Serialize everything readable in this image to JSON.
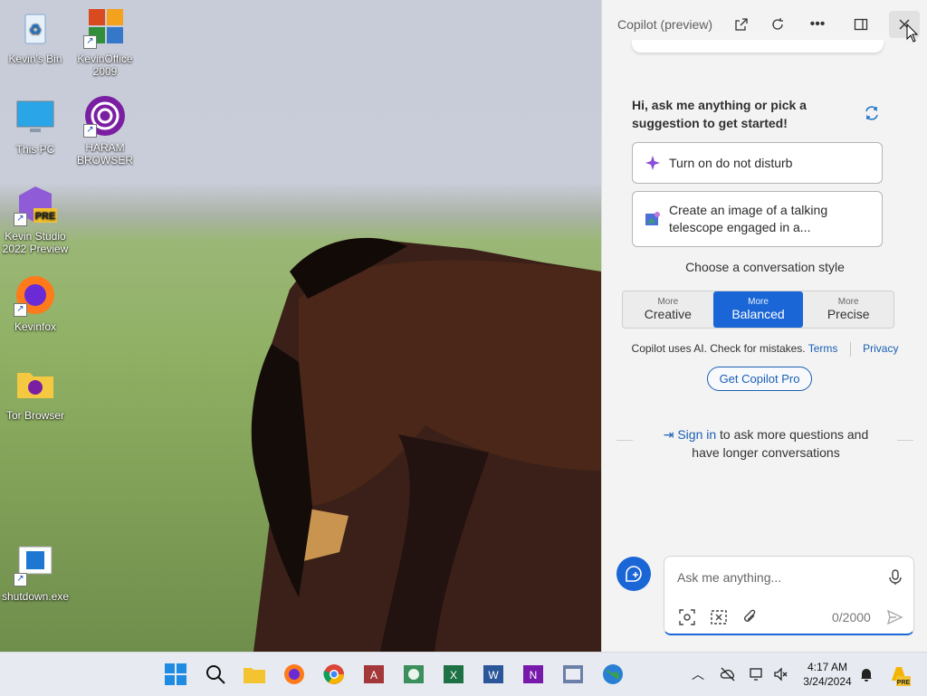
{
  "desktop": {
    "icons": [
      {
        "label": "Kevin's Bin",
        "icon": "recycle-bin-icon"
      },
      {
        "label": "KevinOffice 2009",
        "icon": "office-icon"
      },
      {
        "label": "This PC",
        "icon": "monitor-icon"
      },
      {
        "label": "HARAM BROWSER",
        "icon": "tor-purple-icon"
      },
      {
        "label": "Kevin Studio 2022 Preview",
        "icon": "visual-studio-preview-icon"
      },
      {
        "label": "Kevinfox",
        "icon": "firefox-icon"
      },
      {
        "label": "Tor Browser",
        "icon": "folder-icon"
      },
      {
        "label": "shutdown.exe",
        "icon": "exe-icon"
      }
    ],
    "pre_badge": "PRE"
  },
  "copilot": {
    "title": "Copilot (preview)",
    "greeting": "Hi, ask me anything or pick a suggestion to get started!",
    "suggestions": [
      {
        "text": "Turn on do not disturb",
        "icon": "sparkle-icon"
      },
      {
        "text": "Create an image of a talking telescope engaged in a...",
        "icon": "image-create-icon"
      }
    ],
    "style_label": "Choose a conversation style",
    "styles": [
      {
        "small": "More",
        "big": "Creative",
        "active": false
      },
      {
        "small": "More",
        "big": "Balanced",
        "active": true
      },
      {
        "small": "More",
        "big": "Precise",
        "active": false
      }
    ],
    "disclaimer": "Copilot uses AI. Check for mistakes.",
    "terms": "Terms",
    "privacy": "Privacy",
    "pro_button": "Get Copilot Pro",
    "signin_link": "Sign in",
    "signin_rest": " to ask more questions and have longer conversations",
    "ask_placeholder": "Ask me anything...",
    "counter": "0/2000",
    "accent": "#1a66d6"
  },
  "taskbar": {
    "apps": [
      "start-icon",
      "search-icon",
      "file-explorer-icon",
      "firefox-icon",
      "chrome-icon",
      "access-icon",
      "publisher-icon",
      "excel-icon",
      "word-icon",
      "onenote-icon",
      "outlook-icon",
      "globe-icon"
    ],
    "time": "4:17 AM",
    "date": "3/24/2024",
    "pre_badge": "PRE"
  }
}
